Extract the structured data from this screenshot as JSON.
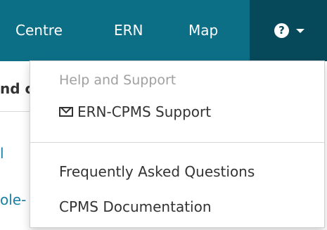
{
  "navbar": {
    "items": [
      {
        "label": "Centre"
      },
      {
        "label": "ERN"
      },
      {
        "label": "Map"
      }
    ],
    "help_glyph": "?",
    "help_icon": "question-circle-icon",
    "caret_icon": "caret-down-icon",
    "background_color": "#0d6f86",
    "active_background_color": "#06495a"
  },
  "background": {
    "heading_fragment": "nd c",
    "link_fragment_1": "l",
    "link_fragment_2": "ole-"
  },
  "dropdown": {
    "header": "Help and Support",
    "items": [
      {
        "label": "ERN-CPMS Support",
        "icon": "envelope-icon"
      },
      {
        "label": "Frequently Asked Questions"
      },
      {
        "label": "CPMS Documentation"
      }
    ]
  }
}
